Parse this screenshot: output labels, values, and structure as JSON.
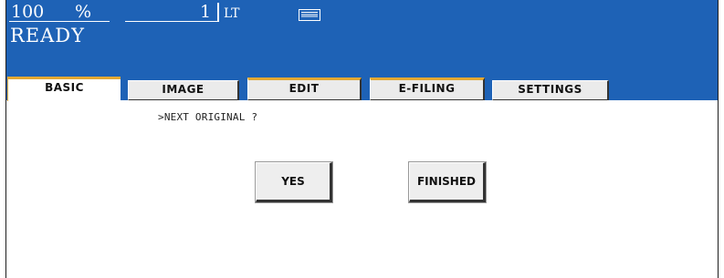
{
  "status": {
    "zoom_value": "100",
    "zoom_unit": "%",
    "copies": "1",
    "paper_size": "LT",
    "tray_icon": "paper-tray-icon",
    "state": "READY"
  },
  "tabs": [
    {
      "label": "BASIC",
      "active": true
    },
    {
      "label": "IMAGE",
      "active": false
    },
    {
      "label": "EDIT",
      "active": false
    },
    {
      "label": "E-FILING",
      "active": false
    },
    {
      "label": "SETTINGS",
      "active": false
    }
  ],
  "prompt": ">NEXT ORIGINAL ?",
  "buttons": {
    "yes": "YES",
    "finished": "FINISHED"
  },
  "colors": {
    "header_blue": "#1e62b6",
    "tab_accent": "#e3a832",
    "button_face": "#eeeeee"
  }
}
